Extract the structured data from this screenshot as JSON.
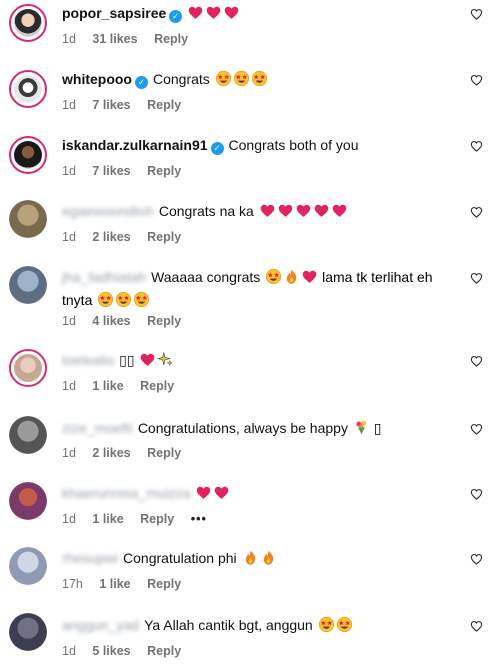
{
  "comments": [
    {
      "username": "popor_sapsiree",
      "verified": true,
      "blurred": false,
      "text": "",
      "emojis": [
        "red-heart",
        "red-heart",
        "red-heart"
      ],
      "time": "1d",
      "likes": "31 likes",
      "reply": "Reply",
      "text2": ""
    },
    {
      "username": "whitepooo",
      "verified": true,
      "blurred": false,
      "text": "Congrats",
      "emojis": [
        "star-struck",
        "star-struck",
        "star-struck"
      ],
      "time": "1d",
      "likes": "7 likes",
      "reply": "Reply",
      "text2": ""
    },
    {
      "username": "iskandar.zulkarnain91",
      "verified": true,
      "blurred": false,
      "text": "Congrats both of you",
      "emojis": [],
      "time": "1d",
      "likes": "7 likes",
      "reply": "Reply",
      "text2": ""
    },
    {
      "username": "egaewoondtoh",
      "verified": false,
      "blurred": true,
      "text": "Congrats na ka",
      "emojis": [
        "red-heart",
        "red-heart",
        "red-heart",
        "red-heart",
        "red-heart"
      ],
      "time": "1d",
      "likes": "2 likes",
      "reply": "Reply",
      "text2": ""
    },
    {
      "username": "jha_fadhiatah",
      "verified": false,
      "blurred": true,
      "text": "Waaaaa congrats",
      "emojis": [
        "star-struck",
        "fire",
        "red-heart"
      ],
      "text_after": "lama tk terlihat eh",
      "text2": "tnyta",
      "emojis2": [
        "star-struck",
        "star-struck",
        "star-struck"
      ],
      "time": "1d",
      "likes": "4 likes",
      "reply": "Reply"
    },
    {
      "username": "toelealio",
      "verified": false,
      "blurred": true,
      "text": "▯▯",
      "emojis": [
        "red-heart",
        "sparkles"
      ],
      "time": "1d",
      "likes": "1 like",
      "reply": "Reply",
      "text2": ""
    },
    {
      "username": "zize_moefti",
      "verified": false,
      "blurred": true,
      "text": "Congratulations, always be happy",
      "emojis": [
        "bouquet"
      ],
      "text_after": "▯",
      "time": "1d",
      "likes": "2 likes",
      "reply": "Reply",
      "text2": ""
    },
    {
      "username": "khaerunnisa_muizza",
      "verified": false,
      "blurred": true,
      "text": "",
      "emojis": [
        "red-heart",
        "red-heart"
      ],
      "time": "1d",
      "likes": "1 like",
      "reply": "Reply",
      "more": "•••",
      "text2": ""
    },
    {
      "username": "rhesupwi",
      "verified": false,
      "blurred": true,
      "text": "Congratulation phi",
      "emojis": [
        "fire",
        "fire"
      ],
      "time": "17h",
      "likes": "1 like",
      "reply": "Reply",
      "text2": ""
    },
    {
      "username": "anggun_yad",
      "verified": false,
      "blurred": true,
      "text": "Ya Allah cantik bgt, anggun",
      "emojis": [
        "star-struck",
        "star-struck"
      ],
      "time": "1d",
      "likes": "5 likes",
      "reply": "Reply",
      "text2": ""
    }
  ],
  "colors": {
    "heart_red": "#e0245e",
    "verified_blue": "#1d9bf0",
    "meta_gray": "#737373",
    "story_ring": "#d62976"
  },
  "icons": {
    "like_button": "heart-outline-icon",
    "verified": "verified-badge-icon"
  }
}
